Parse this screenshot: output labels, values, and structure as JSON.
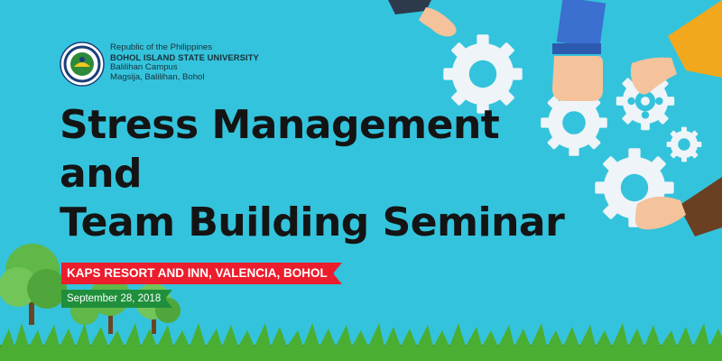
{
  "header": {
    "country": "Republic of the Philippines",
    "university": "BOHOL ISLAND STATE UNIVERSITY",
    "campus": "Balilihan Campus",
    "address": "Magsija, Balilihan, Bohol"
  },
  "title": {
    "line1": "Stress Management",
    "line2": "and",
    "line3": "Team Building Seminar"
  },
  "venue": "KAPS RESORT AND INN, VALENCIA, BOHOL",
  "date": "September 28, 2018",
  "colors": {
    "background": "#34c3dc",
    "venue_ribbon": "#ec1d2c",
    "date_ribbon": "#1f8f3c",
    "grass": "#3f9b2b",
    "gear": "#eef4f7"
  },
  "icons": [
    "university-seal-icon",
    "gear-icon",
    "hand-icon",
    "tree-icon"
  ]
}
